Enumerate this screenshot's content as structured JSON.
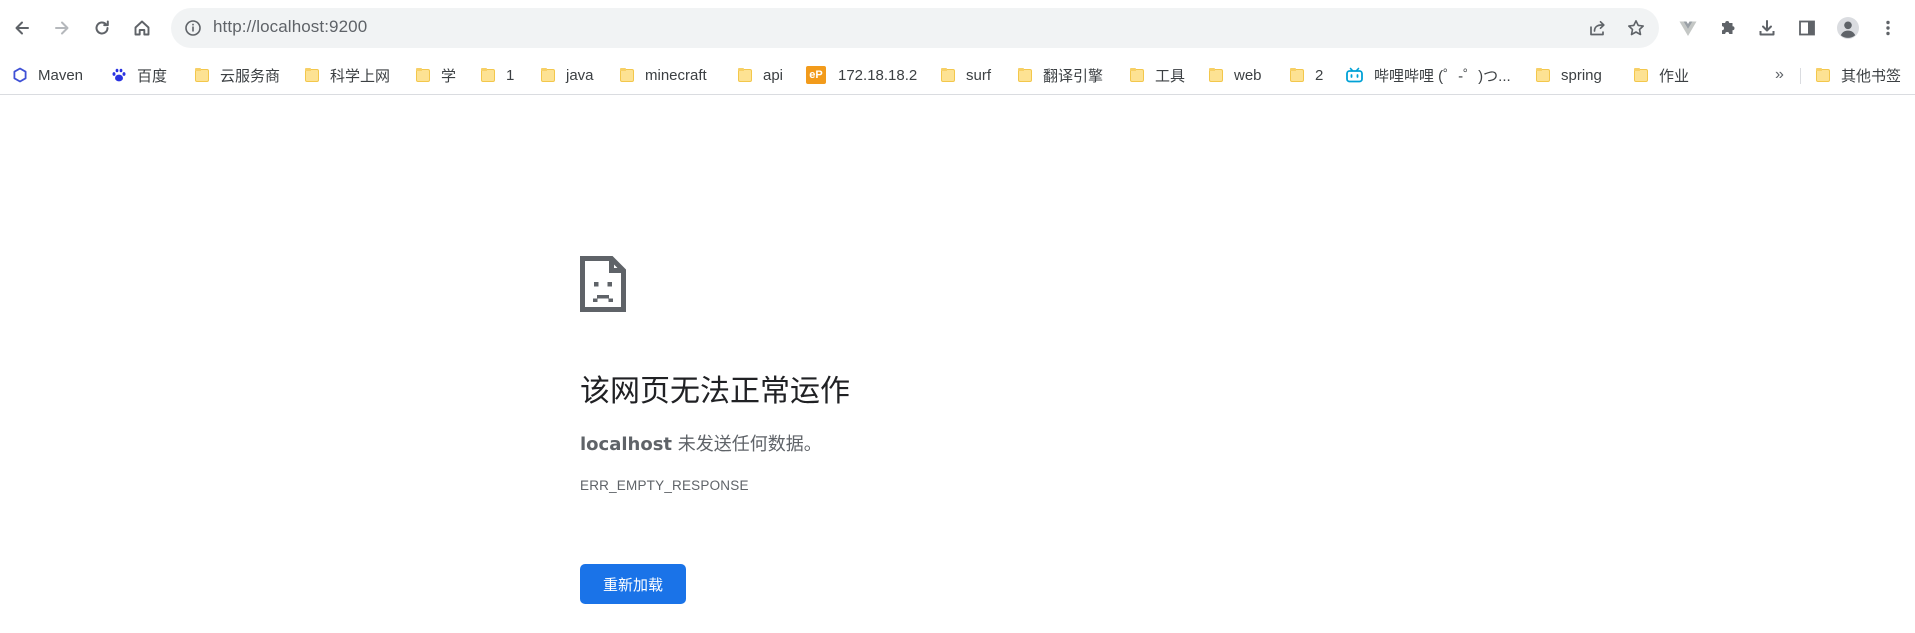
{
  "toolbar": {
    "url_host": "http://localhost",
    "url_port": ":9200"
  },
  "bookmarks": {
    "items": [
      {
        "label": "Maven",
        "icon": "maven-hexagon-icon"
      },
      {
        "label": "百度",
        "icon": "baidu-paw-icon"
      },
      {
        "label": "云服务商",
        "icon": "folder-icon"
      },
      {
        "label": "科学上网",
        "icon": "folder-icon"
      },
      {
        "label": "学",
        "icon": "folder-icon"
      },
      {
        "label": "1",
        "icon": "folder-icon"
      },
      {
        "label": "java",
        "icon": "folder-icon"
      },
      {
        "label": "minecraft",
        "icon": "folder-icon"
      },
      {
        "label": "api",
        "icon": "folder-icon"
      },
      {
        "label": "172.18.18.2",
        "icon": "ep-icon"
      },
      {
        "label": "surf",
        "icon": "folder-icon"
      },
      {
        "label": "翻译引擎",
        "icon": "folder-icon"
      },
      {
        "label": "工具",
        "icon": "folder-icon"
      },
      {
        "label": "web",
        "icon": "folder-icon"
      },
      {
        "label": "2",
        "icon": "folder-icon"
      },
      {
        "label": "哔哩哔哩 (゜-゜)つ...",
        "icon": "bilibili-icon"
      },
      {
        "label": "spring",
        "icon": "folder-icon"
      },
      {
        "label": "作业",
        "icon": "folder-icon"
      }
    ],
    "overflow": "»",
    "other_bookmarks": "其他书签",
    "ep_badge": "eP"
  },
  "error_page": {
    "heading": "该网页无法正常运作",
    "host": "localhost",
    "message": " 未发送任何数据。",
    "code": "ERR_EMPTY_RESPONSE",
    "reload_label": "重新加载"
  },
  "colors": {
    "accent": "#1a73e8",
    "omnibox_bg": "#f1f3f4",
    "folder": "#fde293",
    "bilibili": "#00a1d6",
    "ep_orange": "#f29b1b"
  }
}
